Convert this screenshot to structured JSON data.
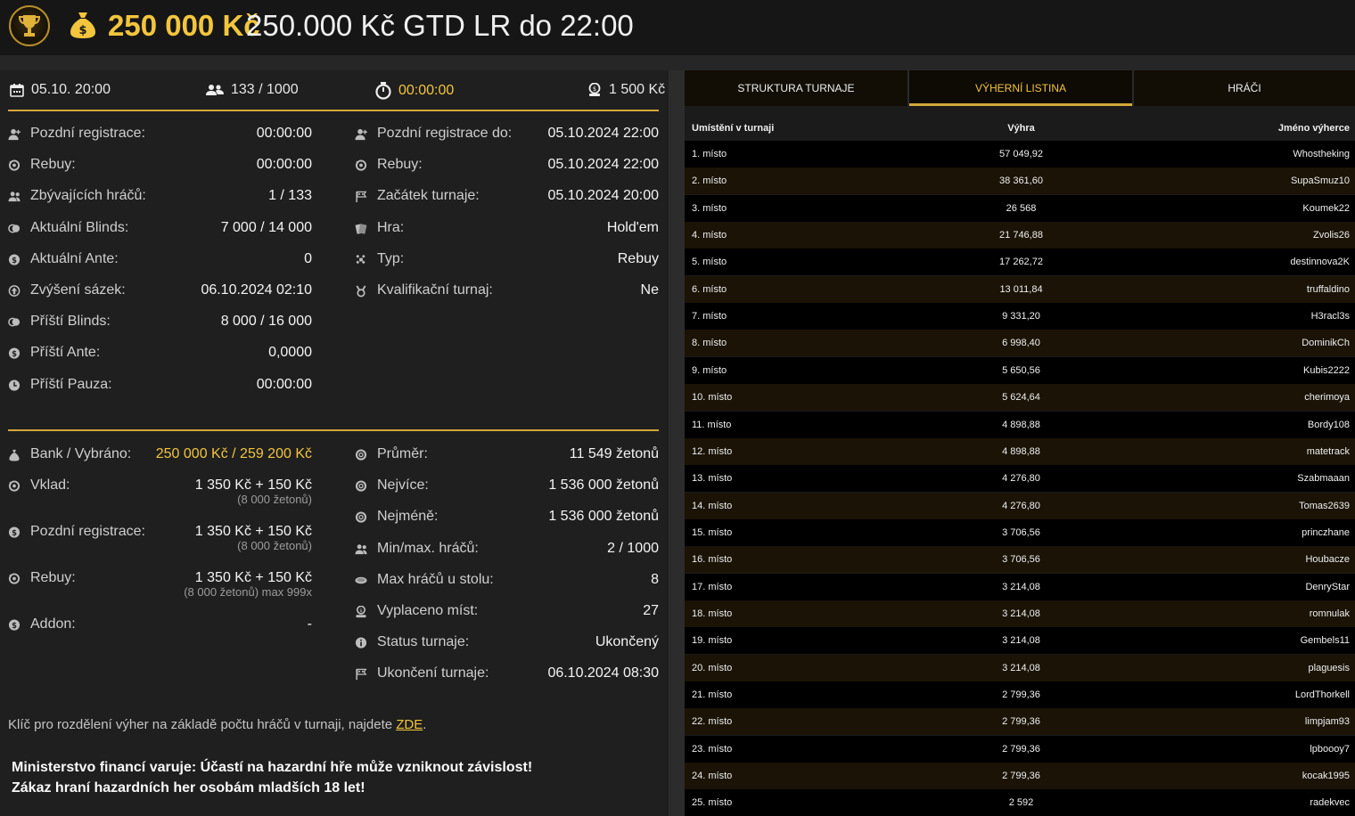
{
  "header": {
    "amount": "250 000 Kč",
    "title": "250.000 Kč GTD LR do 22:00"
  },
  "summary": {
    "date": "05.10. 20:00",
    "players": "133 / 1000",
    "timer": "00:00:00",
    "buyin": "1 500 Kč"
  },
  "info_left": [
    {
      "icon": "user-plus-icon",
      "label": "Pozdní registrace:",
      "value": "00:00:00"
    },
    {
      "icon": "rebuy-icon",
      "label": "Rebuy:",
      "value": "00:00:00"
    },
    {
      "icon": "users-icon",
      "label": "Zbývajících hráčů:",
      "value": "1 / 133"
    },
    {
      "icon": "blinds-icon",
      "label": "Aktuální Blinds:",
      "value": "7 000 / 14 000"
    },
    {
      "icon": "coin-icon",
      "label": "Aktuální Ante:",
      "value": "0"
    },
    {
      "icon": "level-up-icon",
      "label": "Zvýšení sázek:",
      "value": "06.10.2024 02:10"
    },
    {
      "icon": "blinds-icon",
      "label": "Příští Blinds:",
      "value": "8 000 / 16 000"
    },
    {
      "icon": "coin-icon",
      "label": "Příští Ante:",
      "value": "0,0000"
    },
    {
      "icon": "clock-icon",
      "label": "Příští Pauza:",
      "value": "00:00:00"
    }
  ],
  "info_right": [
    {
      "icon": "user-plus-icon",
      "label": "Pozdní registrace do:",
      "value": "05.10.2024 22:00"
    },
    {
      "icon": "rebuy-icon",
      "label": "Rebuy:",
      "value": "05.10.2024 22:00"
    },
    {
      "icon": "flag-icon",
      "label": "Začátek turnaje:",
      "value": "05.10.2024 20:00"
    },
    {
      "icon": "cards-icon",
      "label": "Hra:",
      "value": "Hold'em"
    },
    {
      "icon": "grid-icon",
      "label": "Typ:",
      "value": "Rebuy"
    },
    {
      "icon": "medal-icon",
      "label": "Kvalifikační turnaj:",
      "value": "Ne"
    }
  ],
  "prize_left": [
    {
      "icon": "bank-icon",
      "label": "Bank / Vybráno:",
      "value": "250 000 Kč / 259 200 Kč",
      "sub": ""
    },
    {
      "icon": "rebuy-icon",
      "label": "Vklad:",
      "value": "1 350 Kč + 150 Kč",
      "sub": "(8 000 žetonů)"
    },
    {
      "icon": "coin-icon",
      "label": "Pozdní registrace:",
      "value": "1 350 Kč + 150 Kč",
      "sub": "(8 000 žetonů)"
    },
    {
      "icon": "rebuy-icon",
      "label": "Rebuy:",
      "value": "1 350 Kč + 150 Kč",
      "sub": "(8 000 žetonů) max 999x"
    },
    {
      "icon": "coin-icon",
      "label": "Addon:",
      "value": "-",
      "sub": ""
    }
  ],
  "prize_right": [
    {
      "icon": "chip-icon",
      "label": "Průměr:",
      "value": "11 549 žetonů"
    },
    {
      "icon": "chip-icon",
      "label": "Nejvíce:",
      "value": "1 536 000 žetonů"
    },
    {
      "icon": "chip-icon",
      "label": "Nejméně:",
      "value": "1 536 000 žetonů"
    },
    {
      "icon": "users-icon",
      "label": "Min/max. hráčů:",
      "value": "2 / 1000"
    },
    {
      "icon": "table-icon",
      "label": "Max hráčů u stolu:",
      "value": "8"
    },
    {
      "icon": "paid-icon",
      "label": "Vyplaceno míst:",
      "value": "27"
    },
    {
      "icon": "info-icon",
      "label": "Status turnaje:",
      "value": "Ukončený"
    },
    {
      "icon": "flag-icon",
      "label": "Ukončení turnaje:",
      "value": "06.10.2024 08:30"
    }
  ],
  "note": {
    "text": "Klíč pro rozdělení výher na základě počtu hráčů v turnaji, najdete ",
    "link": "ZDE",
    "end": "."
  },
  "warning": {
    "line1": "Ministerstvo financí varuje: Účastí na hazardní hře může vzniknout závislost!",
    "line2": "Zákaz hraní hazardních her osobám mladších 18 let!"
  },
  "tabs": [
    "STRUKTURA TURNAJE",
    "VÝHERNÍ LISTINA",
    "HRÁČI"
  ],
  "table": {
    "headers": [
      "Umístění v turnaji",
      "Výhra",
      "Jméno výherce"
    ],
    "rows": [
      [
        "1. místo",
        "57 049,92",
        "Whostheking"
      ],
      [
        "2. místo",
        "38 361,60",
        "SupaSmuz10"
      ],
      [
        "3. místo",
        "26 568",
        "Koumek22"
      ],
      [
        "4. místo",
        "21 746,88",
        "Zvolis26"
      ],
      [
        "5. místo",
        "17 262,72",
        "destinnova2K"
      ],
      [
        "6. místo",
        "13 011,84",
        "truffaldino"
      ],
      [
        "7. místo",
        "9 331,20",
        "H3racl3s"
      ],
      [
        "8. místo",
        "6 998,40",
        "DominikCh"
      ],
      [
        "9. místo",
        "5 650,56",
        "Kubis2222"
      ],
      [
        "10. místo",
        "5 624,64",
        "cherimoya"
      ],
      [
        "11. místo",
        "4 898,88",
        "Bordy108"
      ],
      [
        "12. místo",
        "4 898,88",
        "matetrack"
      ],
      [
        "13. místo",
        "4 276,80",
        "Szabmaaan"
      ],
      [
        "14. místo",
        "4 276,80",
        "Tomas2639"
      ],
      [
        "15. místo",
        "3 706,56",
        "princzhane"
      ],
      [
        "16. místo",
        "3 706,56",
        "Houbacze"
      ],
      [
        "17. místo",
        "3 214,08",
        "DenryStar"
      ],
      [
        "18. místo",
        "3 214,08",
        "romnulak"
      ],
      [
        "19. místo",
        "3 214,08",
        "Gembels11"
      ],
      [
        "20. místo",
        "3 214,08",
        "plaguesis"
      ],
      [
        "21. místo",
        "2 799,36",
        "LordThorkell"
      ],
      [
        "22. místo",
        "2 799,36",
        "limpjam93"
      ],
      [
        "23. místo",
        "2 799,36",
        "lpboooy7"
      ],
      [
        "24. místo",
        "2 799,36",
        "kocak1995"
      ],
      [
        "25. místo",
        "2 592",
        "radekvec"
      ]
    ]
  }
}
